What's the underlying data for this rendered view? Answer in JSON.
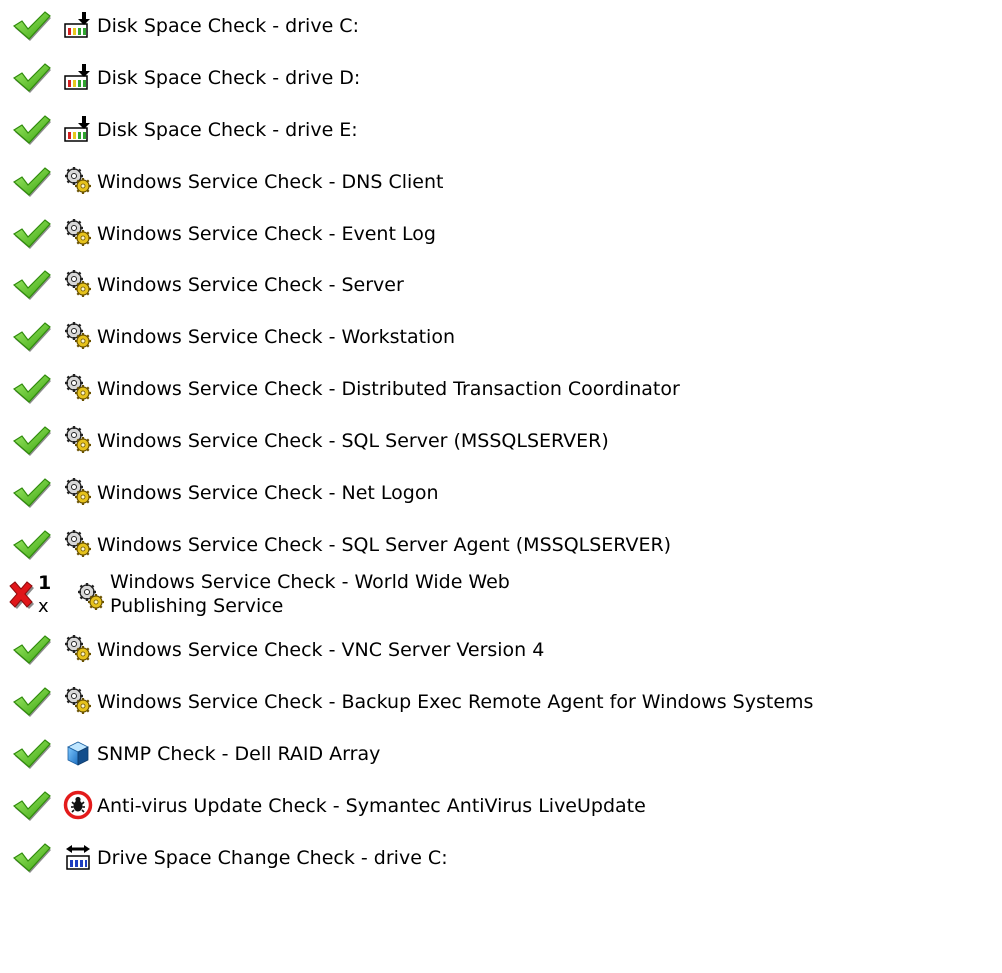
{
  "checks": [
    {
      "status": "ok",
      "icon": "disk-icon",
      "label": "Disk Space Check - drive C:"
    },
    {
      "status": "ok",
      "icon": "disk-icon",
      "label": "Disk Space Check - drive D:"
    },
    {
      "status": "ok",
      "icon": "disk-icon",
      "label": "Disk Space Check - drive E:"
    },
    {
      "status": "ok",
      "icon": "service-gears-icon",
      "label": "Windows Service Check - DNS Client"
    },
    {
      "status": "ok",
      "icon": "service-gears-icon",
      "label": "Windows Service Check - Event Log"
    },
    {
      "status": "ok",
      "icon": "service-gears-icon",
      "label": "Windows Service Check - Server"
    },
    {
      "status": "ok",
      "icon": "service-gears-icon",
      "label": "Windows Service Check - Workstation"
    },
    {
      "status": "ok",
      "icon": "service-gears-icon",
      "label": "Windows Service Check - Distributed Transaction Coordinator"
    },
    {
      "status": "ok",
      "icon": "service-gears-icon",
      "label": "Windows Service Check - SQL Server (MSSQLSERVER)"
    },
    {
      "status": "ok",
      "icon": "service-gears-icon",
      "label": "Windows Service Check - Net Logon"
    },
    {
      "status": "ok",
      "icon": "service-gears-icon",
      "label": "Windows Service Check - SQL Server Agent (MSSQLSERVER)"
    },
    {
      "status": "failed",
      "icon": "service-gears-icon",
      "label": "Windows Service Check - World Wide Web Publishing Service",
      "fail_count": "1",
      "fail_mult": "x"
    },
    {
      "status": "ok",
      "icon": "service-gears-icon",
      "label": "Windows Service Check - VNC Server Version 4"
    },
    {
      "status": "ok",
      "icon": "service-gears-icon",
      "label": "Windows Service Check - Backup Exec Remote Agent for Windows Systems"
    },
    {
      "status": "ok",
      "icon": "snmp-cube-icon",
      "label": "SNMP Check - Dell RAID Array"
    },
    {
      "status": "ok",
      "icon": "antivirus-icon",
      "label": "Anti-virus Update Check - Symantec AntiVirus LiveUpdate"
    },
    {
      "status": "ok",
      "icon": "drive-change-icon",
      "label": "Drive Space Change Check - drive C:"
    }
  ],
  "colors": {
    "ok": "#5fc21a",
    "failed": "#e0161a",
    "gear": "#e6c21c",
    "snmp": "#2f8fd8",
    "antivirus": "#e31b1b",
    "drive_change": "#1f3fbf"
  }
}
